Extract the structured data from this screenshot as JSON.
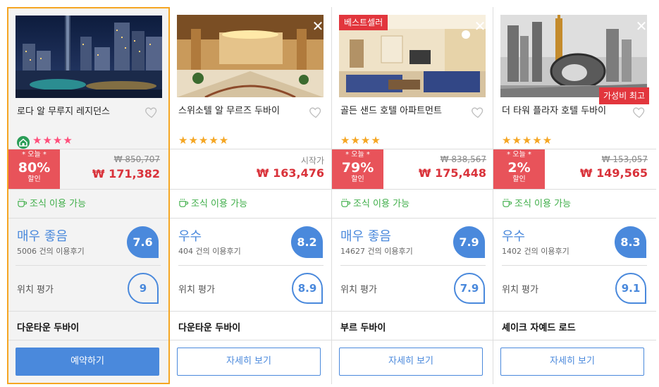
{
  "hotels": [
    {
      "name": "로다 알 무루지 레지던스",
      "stars": "★★★★",
      "original_price": "₩ 850,707",
      "price": "₩ 171,382",
      "deal_today": "* 오늘 *",
      "discount": "80%",
      "discount_label": "할인",
      "breakfast": "조식 이용 가능",
      "rating_label": "매우 좋음",
      "reviews": "5006 건의 이용후기",
      "score": "7.6",
      "location_label": "위치 평가",
      "location_score": "9",
      "area": "다운타운 두바이",
      "button": "예약하기"
    },
    {
      "name": "스위소텔 알 무르즈 두바이",
      "stars": "★★★★★",
      "price_prefix": "시작가",
      "price": "₩ 163,476",
      "breakfast": "조식 이용 가능",
      "rating_label": "우수",
      "reviews": "404 건의 이용후기",
      "score": "8.2",
      "location_label": "위치 평가",
      "location_score": "8.9",
      "area": "다운타운 두바이",
      "button": "자세히 보기"
    },
    {
      "name": "골든 샌드 호텔 아파트먼트",
      "badge": "베스트셀러",
      "stars": "★★★★",
      "original_price": "₩ 838,567",
      "price": "₩ 175,448",
      "deal_today": "* 오늘 *",
      "discount": "79%",
      "discount_label": "할인",
      "breakfast": "조식 이용 가능",
      "rating_label": "매우 좋음",
      "reviews": "14627 건의 이용후기",
      "score": "7.9",
      "location_label": "위치 평가",
      "location_score": "7.9",
      "area": "부르 두바이",
      "button": "자세히 보기"
    },
    {
      "name": "더 타워 플라자 호텔 두바이",
      "badge": "가성비 최고",
      "stars": "★★★★★",
      "original_price": "₩ 153,057",
      "price": "₩ 149,565",
      "deal_today": "* 오늘 *",
      "discount": "2%",
      "discount_label": "할인",
      "breakfast": "조식 이용 가능",
      "rating_label": "우수",
      "reviews": "1402 건의 이용후기",
      "score": "8.3",
      "location_label": "위치 평가",
      "location_score": "9.1",
      "area": "셰이크 자예드 로드",
      "button": "자세히 보기"
    }
  ],
  "colors": {
    "selected_border": "#f5a623",
    "price_red": "#d9323a",
    "deal_bg": "#e8535a",
    "rating_blue": "#4a89dc",
    "breakfast_green": "#3fae49",
    "badge_red": "#e2363d"
  },
  "icons": [
    "close-icon",
    "heart-icon",
    "home-icon",
    "cup-icon",
    "star-icon"
  ]
}
